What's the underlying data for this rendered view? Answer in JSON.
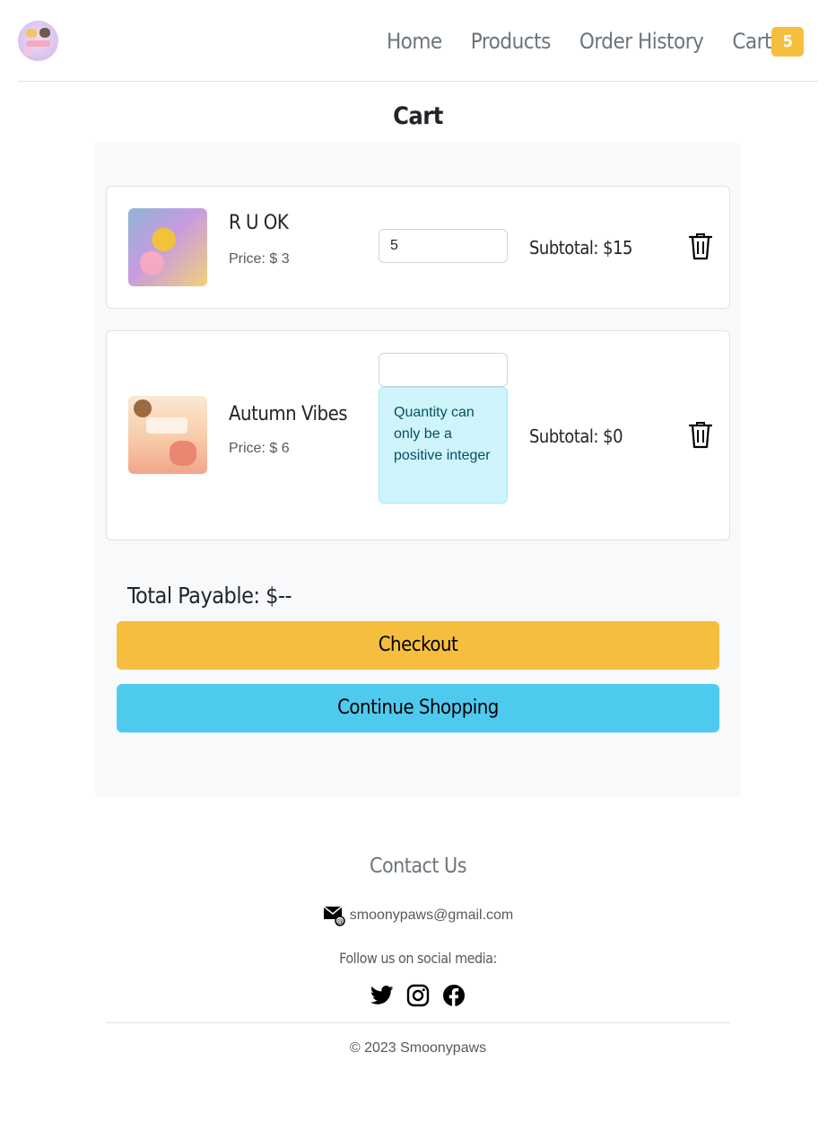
{
  "nav": {
    "items": [
      "Home",
      "Products",
      "Order History"
    ],
    "cart_label": "Cart",
    "cart_count": "5"
  },
  "page_title": "Cart",
  "cart": {
    "items": [
      {
        "name": "R U OK",
        "price": "Price: $ 3",
        "quantity": "5",
        "subtotal": "Subtotal: $15"
      },
      {
        "name": "Autumn Vibes",
        "price": "Price: $ 6",
        "quantity": "",
        "alert": "Quantity can only be a positive integer",
        "subtotal": "Subtotal: $0"
      }
    ],
    "total": "Total Payable: $--",
    "checkout_label": "Checkout",
    "continue_label": "Continue Shopping"
  },
  "colors": {
    "accent_yellow": "#f6be3f",
    "accent_blue": "#4fcaef",
    "alert_bg": "#cff4fc"
  },
  "footer": {
    "contact_title": "Contact Us",
    "email": "smoonypaws@gmail.com",
    "follow": "Follow us on social media:",
    "social_icons": [
      "twitter-icon",
      "instagram-icon",
      "facebook-icon"
    ],
    "copyright": "© 2023 Smoonypaws"
  }
}
